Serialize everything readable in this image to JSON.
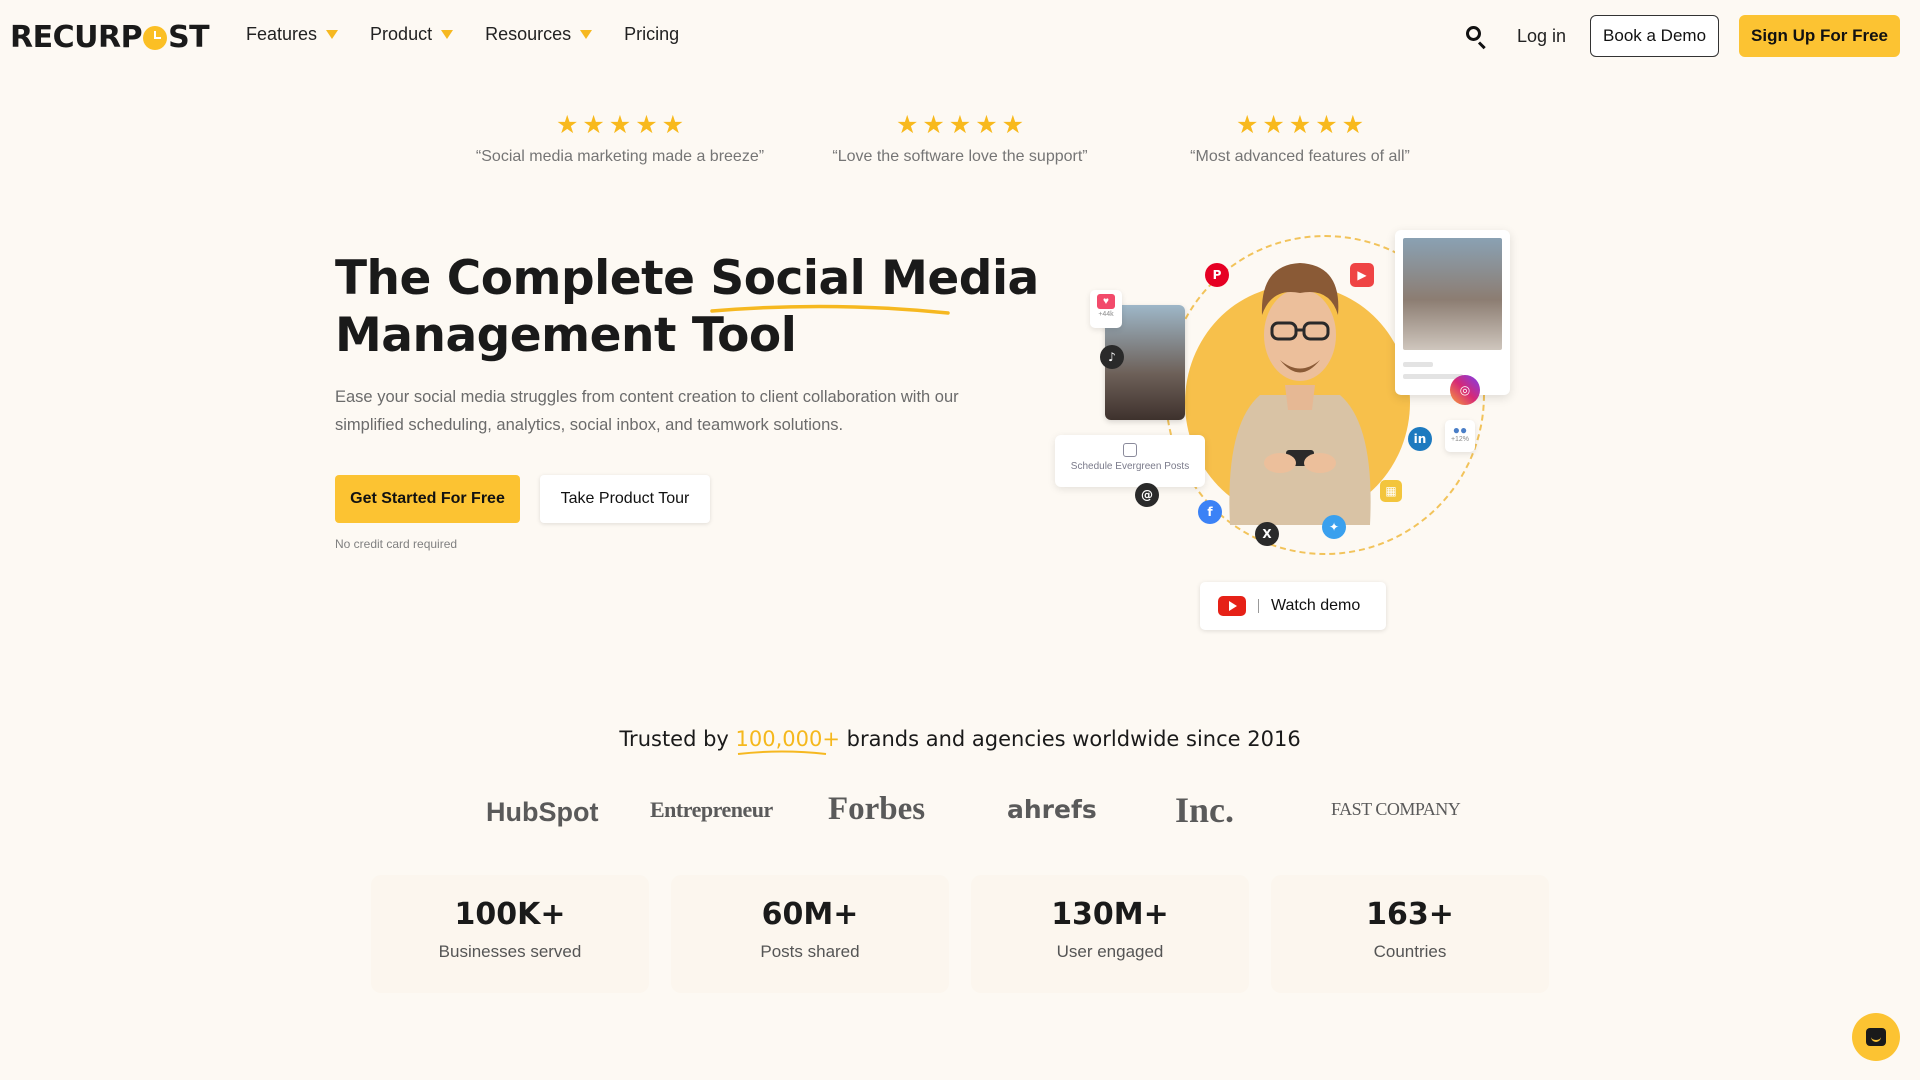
{
  "nav": {
    "logo_text_left": "RECURP",
    "logo_text_right": "ST",
    "menu": [
      {
        "label": "Features"
      },
      {
        "label": "Product"
      },
      {
        "label": "Resources"
      },
      {
        "label": "Pricing"
      }
    ],
    "login": "Log in",
    "book_demo": "Book a Demo",
    "signup": "Sign Up For Free"
  },
  "reviews": [
    {
      "rating": 5,
      "text": "“Social media marketing made a breeze”"
    },
    {
      "rating": 5,
      "text": "“Love the software love the support”"
    },
    {
      "rating": 5,
      "text": "“Most advanced features of all”"
    }
  ],
  "hero": {
    "title_part1": "The Complete ",
    "title_highlight": "Social Media",
    "title_part2": "Management Tool",
    "subtitle": "Ease your social media struggles from content creation to client collaboration with our simplified scheduling, analytics, social inbox, and teamwork solutions.",
    "cta_primary": "Get Started For Free",
    "cta_secondary": "Take Product Tour",
    "note": "No credit card required"
  },
  "illustration": {
    "schedule_label": "Schedule Evergreen Posts",
    "likes": "+44k",
    "followers": "+12%",
    "icons": [
      "pinterest-icon",
      "youtube-icon",
      "tiktok-icon",
      "instagram-icon",
      "linkedin-icon",
      "threads-icon",
      "facebook-icon",
      "x-icon",
      "bluesky-icon",
      "google-business-icon"
    ]
  },
  "watch_demo": "Watch demo",
  "trusted": {
    "prefix": "Trusted by ",
    "count": "100,000+",
    "suffix": " brands and agencies worldwide since 2016"
  },
  "brands": [
    "HubSpot",
    "Entrepreneur",
    "Forbes",
    "ahrefs",
    "Inc.",
    "FAST COMPANY"
  ],
  "stats": [
    {
      "value": "100K+",
      "label": "Businesses served"
    },
    {
      "value": "60M+",
      "label": "Posts shared"
    },
    {
      "value": "130M+",
      "label": "User engaged"
    },
    {
      "value": "163+",
      "label": "Countries"
    }
  ],
  "colors": {
    "accent": "#fcc332",
    "background": "#fdf9f3",
    "star": "#f8b91d"
  }
}
